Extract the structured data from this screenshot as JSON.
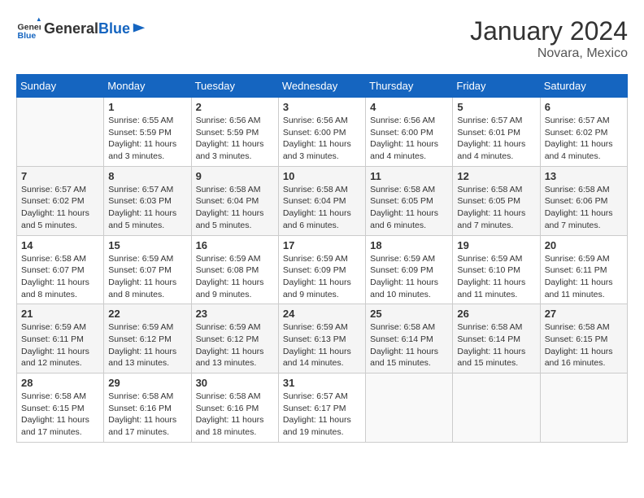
{
  "header": {
    "logo_general": "General",
    "logo_blue": "Blue",
    "month_year": "January 2024",
    "location": "Novara, Mexico"
  },
  "weekdays": [
    "Sunday",
    "Monday",
    "Tuesday",
    "Wednesday",
    "Thursday",
    "Friday",
    "Saturday"
  ],
  "weeks": [
    [
      {
        "day": "",
        "info": ""
      },
      {
        "day": "1",
        "info": "Sunrise: 6:55 AM\nSunset: 5:59 PM\nDaylight: 11 hours\nand 3 minutes."
      },
      {
        "day": "2",
        "info": "Sunrise: 6:56 AM\nSunset: 5:59 PM\nDaylight: 11 hours\nand 3 minutes."
      },
      {
        "day": "3",
        "info": "Sunrise: 6:56 AM\nSunset: 6:00 PM\nDaylight: 11 hours\nand 3 minutes."
      },
      {
        "day": "4",
        "info": "Sunrise: 6:56 AM\nSunset: 6:00 PM\nDaylight: 11 hours\nand 4 minutes."
      },
      {
        "day": "5",
        "info": "Sunrise: 6:57 AM\nSunset: 6:01 PM\nDaylight: 11 hours\nand 4 minutes."
      },
      {
        "day": "6",
        "info": "Sunrise: 6:57 AM\nSunset: 6:02 PM\nDaylight: 11 hours\nand 4 minutes."
      }
    ],
    [
      {
        "day": "7",
        "info": "Sunrise: 6:57 AM\nSunset: 6:02 PM\nDaylight: 11 hours\nand 5 minutes."
      },
      {
        "day": "8",
        "info": "Sunrise: 6:57 AM\nSunset: 6:03 PM\nDaylight: 11 hours\nand 5 minutes."
      },
      {
        "day": "9",
        "info": "Sunrise: 6:58 AM\nSunset: 6:04 PM\nDaylight: 11 hours\nand 5 minutes."
      },
      {
        "day": "10",
        "info": "Sunrise: 6:58 AM\nSunset: 6:04 PM\nDaylight: 11 hours\nand 6 minutes."
      },
      {
        "day": "11",
        "info": "Sunrise: 6:58 AM\nSunset: 6:05 PM\nDaylight: 11 hours\nand 6 minutes."
      },
      {
        "day": "12",
        "info": "Sunrise: 6:58 AM\nSunset: 6:05 PM\nDaylight: 11 hours\nand 7 minutes."
      },
      {
        "day": "13",
        "info": "Sunrise: 6:58 AM\nSunset: 6:06 PM\nDaylight: 11 hours\nand 7 minutes."
      }
    ],
    [
      {
        "day": "14",
        "info": "Sunrise: 6:58 AM\nSunset: 6:07 PM\nDaylight: 11 hours\nand 8 minutes."
      },
      {
        "day": "15",
        "info": "Sunrise: 6:59 AM\nSunset: 6:07 PM\nDaylight: 11 hours\nand 8 minutes."
      },
      {
        "day": "16",
        "info": "Sunrise: 6:59 AM\nSunset: 6:08 PM\nDaylight: 11 hours\nand 9 minutes."
      },
      {
        "day": "17",
        "info": "Sunrise: 6:59 AM\nSunset: 6:09 PM\nDaylight: 11 hours\nand 9 minutes."
      },
      {
        "day": "18",
        "info": "Sunrise: 6:59 AM\nSunset: 6:09 PM\nDaylight: 11 hours\nand 10 minutes."
      },
      {
        "day": "19",
        "info": "Sunrise: 6:59 AM\nSunset: 6:10 PM\nDaylight: 11 hours\nand 11 minutes."
      },
      {
        "day": "20",
        "info": "Sunrise: 6:59 AM\nSunset: 6:11 PM\nDaylight: 11 hours\nand 11 minutes."
      }
    ],
    [
      {
        "day": "21",
        "info": "Sunrise: 6:59 AM\nSunset: 6:11 PM\nDaylight: 11 hours\nand 12 minutes."
      },
      {
        "day": "22",
        "info": "Sunrise: 6:59 AM\nSunset: 6:12 PM\nDaylight: 11 hours\nand 13 minutes."
      },
      {
        "day": "23",
        "info": "Sunrise: 6:59 AM\nSunset: 6:12 PM\nDaylight: 11 hours\nand 13 minutes."
      },
      {
        "day": "24",
        "info": "Sunrise: 6:59 AM\nSunset: 6:13 PM\nDaylight: 11 hours\nand 14 minutes."
      },
      {
        "day": "25",
        "info": "Sunrise: 6:58 AM\nSunset: 6:14 PM\nDaylight: 11 hours\nand 15 minutes."
      },
      {
        "day": "26",
        "info": "Sunrise: 6:58 AM\nSunset: 6:14 PM\nDaylight: 11 hours\nand 15 minutes."
      },
      {
        "day": "27",
        "info": "Sunrise: 6:58 AM\nSunset: 6:15 PM\nDaylight: 11 hours\nand 16 minutes."
      }
    ],
    [
      {
        "day": "28",
        "info": "Sunrise: 6:58 AM\nSunset: 6:15 PM\nDaylight: 11 hours\nand 17 minutes."
      },
      {
        "day": "29",
        "info": "Sunrise: 6:58 AM\nSunset: 6:16 PM\nDaylight: 11 hours\nand 17 minutes."
      },
      {
        "day": "30",
        "info": "Sunrise: 6:58 AM\nSunset: 6:16 PM\nDaylight: 11 hours\nand 18 minutes."
      },
      {
        "day": "31",
        "info": "Sunrise: 6:57 AM\nSunset: 6:17 PM\nDaylight: 11 hours\nand 19 minutes."
      },
      {
        "day": "",
        "info": ""
      },
      {
        "day": "",
        "info": ""
      },
      {
        "day": "",
        "info": ""
      }
    ]
  ]
}
